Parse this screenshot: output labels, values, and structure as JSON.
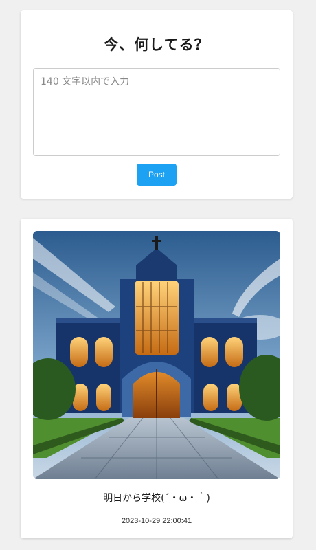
{
  "compose": {
    "title": "今、何してる？",
    "placeholder": "140 文字以内で入力",
    "value": "",
    "post_label": "Post"
  },
  "feed": [
    {
      "image_subject": "cathedral-style school building illustration",
      "text": "明日から学校(´・ω・｀)",
      "timestamp": "2023-10-29 22:00:41"
    }
  ],
  "colors": {
    "page_background": "#f0f0f0",
    "card_background": "#ffffff",
    "button": "#1da1f2"
  }
}
